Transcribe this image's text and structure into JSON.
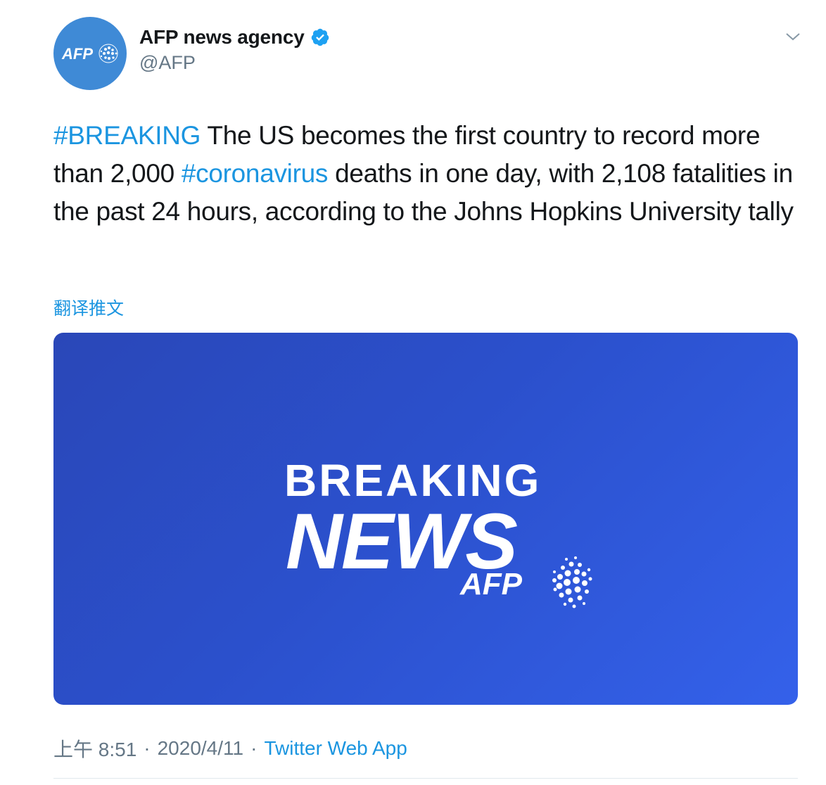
{
  "author": {
    "display_name": "AFP news agency",
    "handle": "@AFP",
    "avatar_text": "AFP"
  },
  "tweet": {
    "segments": [
      {
        "type": "hashtag",
        "text": "#BREAKING"
      },
      {
        "type": "text",
        "text": " The US becomes the first country to record more than 2,000 "
      },
      {
        "type": "hashtag",
        "text": "#coronavirus"
      },
      {
        "type": "text",
        "text": " deaths in one day, with 2,108 fatalities in the past 24 hours, according to the Johns Hopkins University tally"
      }
    ],
    "translate_label": "翻译推文"
  },
  "media": {
    "line1": "BREAKING",
    "line2": "NEWS",
    "brand": "AFP"
  },
  "meta": {
    "time": "上午 8:51",
    "separator": "·",
    "date": "2020/4/11",
    "source": "Twitter Web App"
  },
  "colors": {
    "link": "#1b95e0",
    "secondary_text": "#657786",
    "avatar_bg": "#3f8ad6",
    "media_bg_start": "#2a47b8",
    "media_bg_end": "#3461ea"
  },
  "icons": {
    "verified": "verified-badge-icon",
    "menu": "chevron-down-icon"
  }
}
